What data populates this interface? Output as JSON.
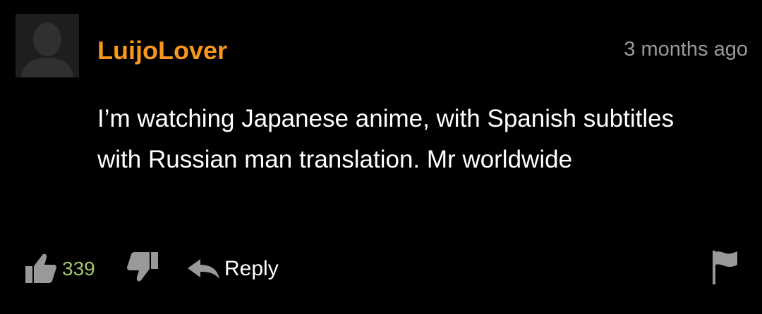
{
  "comment": {
    "username": "LuijoLover",
    "timestamp": "3 months ago",
    "body": "I’m watching Japanese anime, with Spanish subtitles with Russian man translation. Mr worldwide",
    "likes": "339",
    "reply_label": "Reply"
  },
  "colors": {
    "background": "#000000",
    "username": "#f7971d",
    "like_count": "#a6c46b",
    "timestamp": "#9a9a9a",
    "icon": "#999999"
  },
  "icons": {
    "avatar": "default-user-silhouette",
    "like": "thumb-up-icon",
    "dislike": "thumb-down-icon",
    "reply": "reply-arrow-icon",
    "flag": "flag-icon"
  }
}
